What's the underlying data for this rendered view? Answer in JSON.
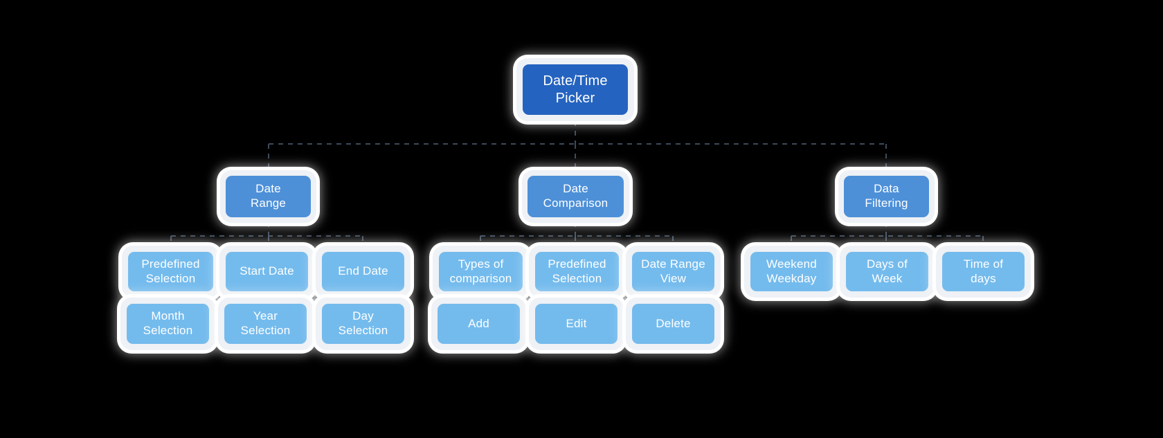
{
  "diagram": {
    "title": "Date/Time Picker",
    "background_color": "#000000",
    "colors": {
      "root_fill": "#2563c0",
      "level2_fill": "#4d90d8",
      "level3_fill": "#74bbed",
      "node_shell": "#eef1f5",
      "node_halo": "#ffffff",
      "connector": "#3d4a5c",
      "label_text": "#ffffff"
    },
    "root": {
      "label": "Date/Time\nPicker"
    },
    "branches": [
      {
        "name": "date-range",
        "parent_label": "Date\nRange",
        "children_row1": [
          {
            "label": "Predefined\nSelection"
          },
          {
            "label": "Start Date"
          },
          {
            "label": "End Date"
          }
        ],
        "children_row2": [
          {
            "label": "Month\nSelection"
          },
          {
            "label": "Year\nSelection"
          },
          {
            "label": "Day\nSelection"
          }
        ]
      },
      {
        "name": "date-comparison",
        "parent_label": "Date\nComparison",
        "children_row1": [
          {
            "label": "Types of\ncomparison"
          },
          {
            "label": "Predefined\nSelection"
          },
          {
            "label": "Date Range\nView"
          }
        ],
        "children_row2": [
          {
            "label": "Add"
          },
          {
            "label": "Edit"
          },
          {
            "label": "Delete"
          }
        ]
      },
      {
        "name": "data-filtering",
        "parent_label": "Data\nFiltering",
        "children_row1": [
          {
            "label": "Weekend\nWeekday"
          },
          {
            "label": "Days of\nWeek"
          },
          {
            "label": "Time of\ndays"
          }
        ],
        "children_row2": []
      }
    ]
  }
}
